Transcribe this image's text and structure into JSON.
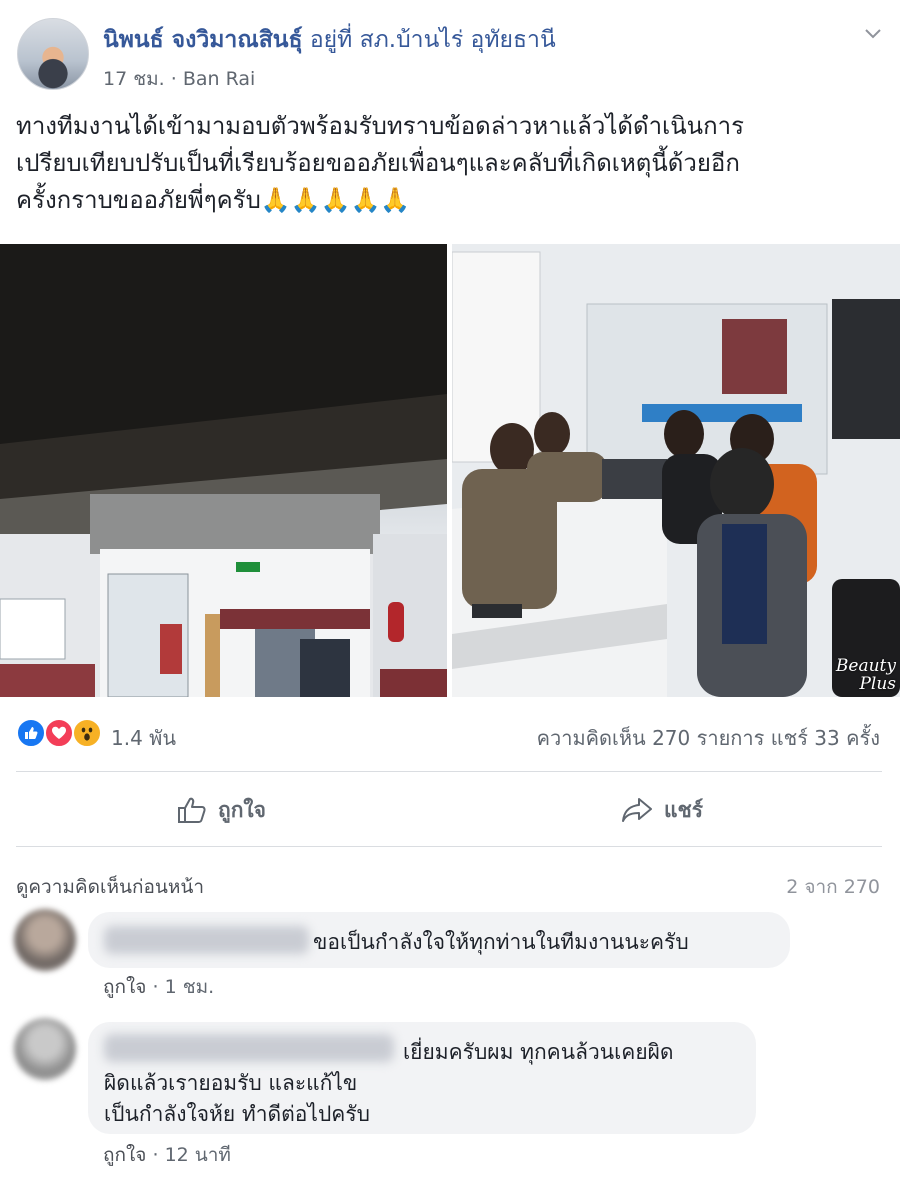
{
  "post": {
    "author": "นิพนธ์ จงวิมาณสินธุ์",
    "location": "อยู่ที่ สภ.บ้านไร่ อุทัยธานี",
    "time": "17 ชม.",
    "separator": "·",
    "place": "Ban Rai",
    "text_lines": [
      "ทางทีมงานได้เข้ามามอบตัวพร้อมรับทราบข้อดล่าวหาแล้วได้ดำเนินการ",
      "เปรียบเทียบปรับเป็นที่เรียบร้อยขออภัยเพื่อนๆและคลับที่เกิดเหตุนี้ด้วยอีก",
      "ครั้งกราบขออภัยพี่ๆครับ🙏🙏🙏🙏🙏"
    ],
    "photo_badge_line1": "Beauty",
    "photo_badge_line2": "Plus"
  },
  "stats": {
    "reaction_count": "1.4 พัน",
    "comments_shares": "ความคิดเห็น 270 รายการ  แชร์ 33 ครั้ง"
  },
  "actions": {
    "like_label": "ถูกใจ",
    "share_label": "แชร์"
  },
  "comments_section": {
    "view_previous": "ดูความคิดเห็นก่อนหน้า",
    "count_label": "2 จาก 270",
    "items": [
      {
        "lines": [
          "ขอเป็นกำลังใจให้ทุกท่านในทีมงานนะครับ"
        ],
        "like_label": "ถูกใจ",
        "separator": "·",
        "time": "1 ชม."
      },
      {
        "lines": [
          "เยี่ยมครับผม ทุกคนล้วนเคยผิด",
          "ผิดแล้วเรายอมรับ และแก้ไข",
          "เป็นกำลังใจห้ย ทำดีต่อไปครับ"
        ],
        "like_label": "ถูกใจ",
        "separator": "·",
        "time": "12 นาที"
      }
    ]
  },
  "colors": {
    "link_blue": "#365899",
    "meta_gray": "#606770",
    "bubble_bg": "#f2f3f5",
    "like_blue": "#1877f2",
    "love_red": "#f33e58",
    "wow_yellow": "#f7b125"
  }
}
